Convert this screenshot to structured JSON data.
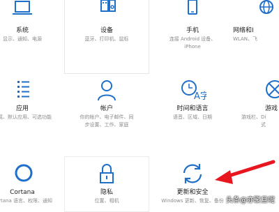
{
  "accent_color": "#1e6fc9",
  "annotation_color": "#e8161e",
  "tiles": [
    {
      "id": "system",
      "icon": "laptop-icon",
      "title": "系统",
      "desc": [
        "显示、通知、电源"
      ]
    },
    {
      "id": "devices",
      "icon": "keyboard-speaker-icon",
      "title": "设备",
      "desc": [
        "蓝牙、打印机、鼠标"
      ]
    },
    {
      "id": "phone",
      "icon": "phone-icon",
      "title": "手机",
      "desc": [
        "连接 Android 设备、",
        "iPhone"
      ]
    },
    {
      "id": "network",
      "icon": "globe-icon",
      "title": "网络和I",
      "desc": [
        "WLAN、飞"
      ]
    },
    {
      "id": "apps",
      "icon": "apps-list-icon",
      "title": "应用",
      "desc": [
        "卸载、默认应用、可选功能"
      ]
    },
    {
      "id": "accounts",
      "icon": "person-icon",
      "title": "帐户",
      "desc": [
        "你的帐户、电子邮件、同",
        "步设置、工作、家庭"
      ]
    },
    {
      "id": "time",
      "icon": "clock-language-icon",
      "title": "时间和语言",
      "desc": [
        "语音、区域、日期"
      ]
    },
    {
      "id": "gaming",
      "icon": "xbox-icon",
      "title": "游戏",
      "desc": [
        "游戏栏、Di",
        "式"
      ]
    },
    {
      "id": "cortana",
      "icon": "cortana-circle-icon",
      "title": "Cortana",
      "desc": [
        "Cortana 语言、权限、通知"
      ]
    },
    {
      "id": "privacy",
      "icon": "lock-icon",
      "title": "隐私",
      "desc": [
        "位置、相机"
      ]
    },
    {
      "id": "update",
      "icon": "sync-arrows-icon",
      "title": "更新和安全",
      "desc": [
        "Windows 更新、恢复、备份"
      ]
    }
  ],
  "watermark": "头条@亦聚旦呢"
}
